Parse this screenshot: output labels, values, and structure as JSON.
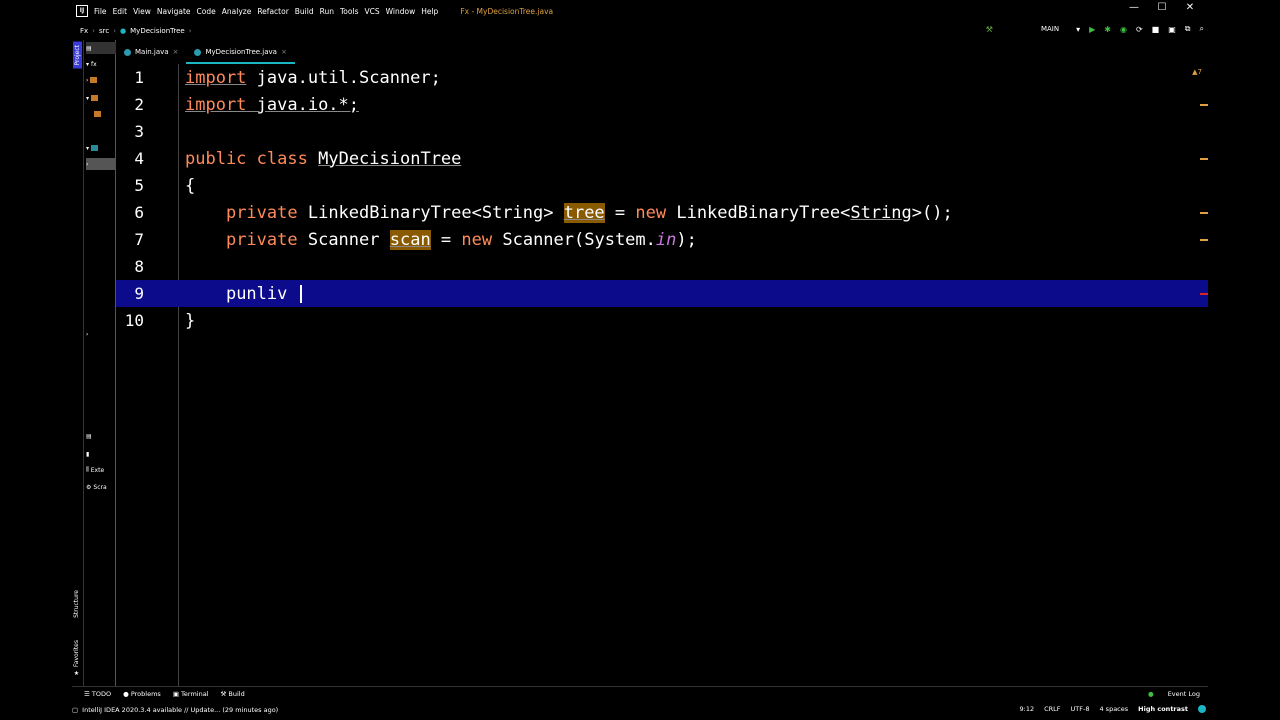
{
  "menu": [
    "File",
    "Edit",
    "View",
    "Navigate",
    "Code",
    "Analyze",
    "Refactor",
    "Build",
    "Run",
    "Tools",
    "VCS",
    "Window",
    "Help"
  ],
  "title": "Fx - MyDecisionTree.java",
  "app_logo": "IJ",
  "breadcrumb": {
    "project": "Fx",
    "src": "src",
    "class": "MyDecisionTree"
  },
  "run_config": "MAIN",
  "tabs": [
    {
      "label": "Main.java",
      "active": false
    },
    {
      "label": "MyDecisionTree.java",
      "active": true
    }
  ],
  "project_panel": {
    "root": "fx",
    "ext_libs": "Exte",
    "scratches": "Scra"
  },
  "side_tabs": {
    "project": "Project",
    "structure": "Structure",
    "favorites": "Favorites"
  },
  "editor": {
    "warnings": "▲7",
    "line_numbers": [
      "1",
      "2",
      "3",
      "4",
      "5",
      "6",
      "7",
      "8",
      "9",
      "10"
    ],
    "lines": {
      "l1_kw": "import",
      "l1_rest": " java.util.Scanner;",
      "l2_kw": "import",
      "l2_rest": " java.io.*;",
      "l4_kw1": "public",
      "l4_kw2": "class",
      "l4_name": "MyDecisionTree",
      "l5": "{",
      "l6_kw": "private",
      "l6_type": " LinkedBinaryTree<String> ",
      "l6_field": "tree",
      "l6_eq": " = ",
      "l6_new": "new",
      "l6_ctor": " LinkedBinaryTree<",
      "l6_gen": "String",
      "l6_end": ">();",
      "l7_kw": "private",
      "l7_type": " Scanner ",
      "l7_field": "scan",
      "l7_eq": " = ",
      "l7_new": "new",
      "l7_ctor": " Scanner(System.",
      "l7_in": "in",
      "l7_end": ");",
      "l9": "punliv ",
      "l10": "}"
    }
  },
  "toolstrip": {
    "todo": "☰ TODO",
    "problems": "● Problems",
    "terminal": "▣ Terminal",
    "build": "⚒ Build",
    "event_log": "Event Log"
  },
  "status": {
    "message": "IntelliJ IDEA 2020.3.4 available // Update... (29 minutes ago)",
    "position": "9:12",
    "line_sep": "CRLF",
    "encoding": "UTF-8",
    "indent": "4 spaces",
    "theme": "High contrast"
  },
  "colors": {
    "keyword": "#ff8a5a",
    "current_line": "#0b0b8c",
    "accent": "#1ab6c4",
    "field_highlight": "#8a5a00"
  }
}
